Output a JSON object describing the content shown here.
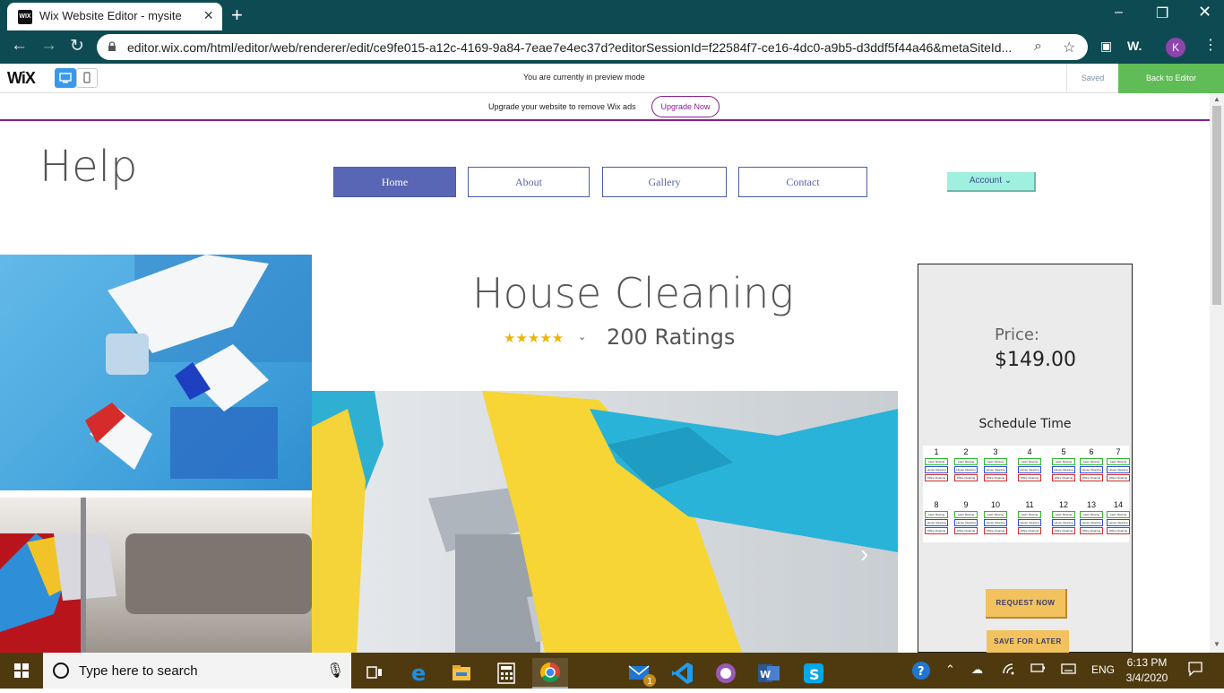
{
  "browser": {
    "tab_title": "Wix Website Editor - mysite",
    "favicon_text": "WIX",
    "url": "editor.wix.com/html/editor/web/renderer/edit/ce9fe015-a12c-4169-9a84-7eae7e4ec37d?editorSessionId=f22584f7-ce16-4dc0-a9b5-d3ddf5f44a46&metaSiteId...",
    "profile_initial": "K",
    "ext_label": "W."
  },
  "wix_bar": {
    "logo": "WiX",
    "preview_text": "You are currently in preview mode",
    "saved_label": "Saved",
    "back_label": "Back to Editor"
  },
  "ad_banner": {
    "text": "Upgrade your website to remove Wix ads",
    "upgrade_label": "Upgrade Now"
  },
  "site": {
    "logo": "Help",
    "nav": [
      "Home",
      "About",
      "Gallery",
      "Contact"
    ],
    "account_label": "Account ⌄",
    "heading": "House Cleaning",
    "stars": "★★★★★",
    "ratings": "200 Ratings",
    "price_label": "Price:",
    "price_value": "$149.00",
    "schedule_label": "Schedule Time",
    "days": [
      "1",
      "2",
      "3",
      "4",
      "5",
      "6",
      "7",
      "8",
      "9",
      "10",
      "11",
      "12",
      "13",
      "14"
    ],
    "slot_labels": [
      "Lawn Mowing",
      "House Cleaning",
      "Office Cleaning"
    ],
    "request_label": "REQUEST NOW",
    "save_label": "SAVE FOR LATER"
  },
  "taskbar": {
    "search_placeholder": "Type here to search",
    "language": "ENG",
    "time": "6:13 PM",
    "date": "3/4/2020",
    "mail_badge": "1"
  }
}
